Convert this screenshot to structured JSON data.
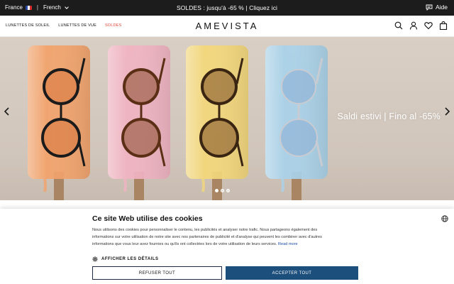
{
  "topbar": {
    "country": "France",
    "language": "French",
    "promo": "SOLDES : jusqu'à -65 % | Cliquez ici",
    "help": "Aide"
  },
  "nav": {
    "links": [
      "LUNETTES DE SOLEIL",
      "LUNETTES DE VUE",
      "SOLDES"
    ],
    "logo": "AMEVISTA",
    "icons": [
      "search-icon",
      "account-icon",
      "wishlist-heart-icon",
      "bag-icon"
    ]
  },
  "hero": {
    "caption": "Saldi estivi | Fino al -65%",
    "slides_total": 3,
    "active_slide": 1,
    "popsicle_colors": [
      "#f2a36a",
      "#f0b3c2",
      "#f3d77a",
      "#a9d2ea"
    ]
  },
  "cookie": {
    "title": "Ce site Web utilise des cookies",
    "body": "Nous utilisons des cookies pour personnaliser le contenu, les publicités et analyser notre trafic. Nous partageons également des informations sur votre utilisation de notre site avec nos partenaires de publicité et d'analyse qui peuvent les combiner avec d'autres informations que vous leur avez fournies ou qu'ils ont collectées lors de votre utilisation de leurs services.",
    "read_more": "Read more",
    "details": "AFFICHER LES DÉTAILS",
    "refuse": "REFUSER TOUT",
    "accept": "ACCEPTER TOUT"
  },
  "colors": {
    "topbar_bg": "#1c1c1c",
    "sale_red": "#e0463a",
    "accept_blue": "#1d4f7c"
  }
}
